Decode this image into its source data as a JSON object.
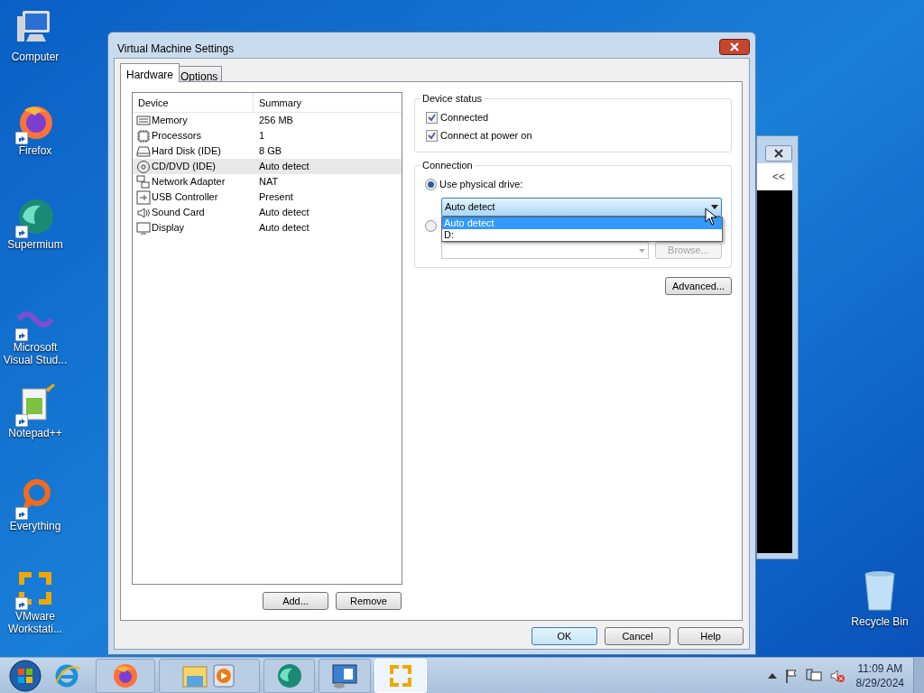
{
  "desktop_icons": [
    {
      "kind": "computer",
      "label": "Computer"
    },
    {
      "kind": "firefox",
      "label": "Firefox",
      "shortcut": true
    },
    {
      "kind": "supermium",
      "label": "Supermium",
      "shortcut": true
    },
    {
      "kind": "visualstudio",
      "label": "Microsoft Visual Stud...",
      "shortcut": true
    },
    {
      "kind": "notepad",
      "label": "Notepad++",
      "shortcut": true
    },
    {
      "kind": "everything",
      "label": "Everything",
      "shortcut": true
    },
    {
      "kind": "vmware",
      "label": "VMware Workstati...",
      "shortcut": true
    }
  ],
  "recycle_bin": {
    "label": "Recycle Bin"
  },
  "background_window": {
    "toolbar_text": "<<"
  },
  "dialog": {
    "title": "Virtual Machine Settings",
    "tabs": [
      {
        "label": "Hardware",
        "selected": true
      },
      {
        "label": "Options",
        "selected": false
      }
    ],
    "device_table": {
      "columns": [
        "Device",
        "Summary"
      ],
      "rows": [
        {
          "kind": "memory",
          "device": "Memory",
          "summary": "256 MB",
          "selected": false
        },
        {
          "kind": "cpu",
          "device": "Processors",
          "summary": "1",
          "selected": false
        },
        {
          "kind": "disk",
          "device": "Hard Disk (IDE)",
          "summary": "8 GB",
          "selected": false
        },
        {
          "kind": "cd",
          "device": "CD/DVD (IDE)",
          "summary": "Auto detect",
          "selected": true
        },
        {
          "kind": "network",
          "device": "Network Adapter",
          "summary": "NAT",
          "selected": false
        },
        {
          "kind": "usb",
          "device": "USB Controller",
          "summary": "Present",
          "selected": false
        },
        {
          "kind": "sound",
          "device": "Sound Card",
          "summary": "Auto detect",
          "selected": false
        },
        {
          "kind": "display",
          "device": "Display",
          "summary": "Auto detect",
          "selected": false
        }
      ]
    },
    "device_status": {
      "title": "Device status",
      "checkboxes": [
        {
          "label": "Connected",
          "checked": true
        },
        {
          "label": "Connect at power on",
          "checked": true
        }
      ]
    },
    "connection": {
      "title": "Connection",
      "physical_drive": {
        "label": "Use physical drive:",
        "selected": true,
        "value": "Auto detect",
        "options": [
          {
            "label": "Auto detect",
            "selected": true
          },
          {
            "label": "D:",
            "selected": false
          }
        ]
      },
      "iso_option": {
        "selected": false,
        "browse_button": {
          "label": "Browse...",
          "disabled": true
        }
      }
    },
    "advanced_button": "Advanced...",
    "list_buttons": [
      "Add...",
      "Remove"
    ],
    "footer_buttons": [
      {
        "label": "OK",
        "default": true
      },
      {
        "label": "Cancel",
        "default": false
      },
      {
        "label": "Help",
        "default": false
      }
    ]
  },
  "taskbar": {
    "apps": [
      {
        "kind": "ie"
      },
      {
        "kind": "firefox",
        "active": false
      },
      {
        "kind": "explorer",
        "active": false
      },
      {
        "kind": "media",
        "active": false
      },
      {
        "kind": "supermium",
        "active": false
      },
      {
        "kind": "control",
        "active": false
      },
      {
        "kind": "vmware",
        "active": true
      }
    ],
    "clock": {
      "time": "11:09 AM",
      "date": "8/29/2024"
    }
  }
}
